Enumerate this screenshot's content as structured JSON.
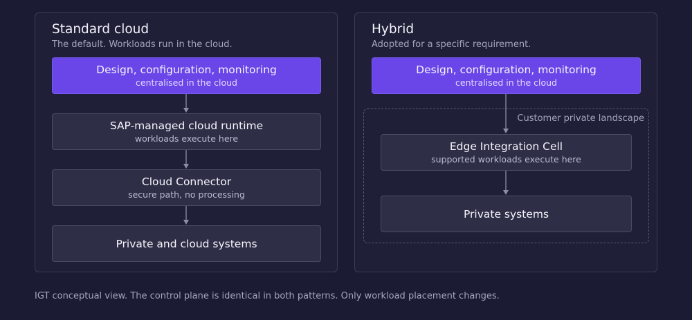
{
  "standard": {
    "title": "Standard cloud",
    "subtitle": "The default. Workloads run in the cloud.",
    "boxes": [
      {
        "title": "Design, configuration, monitoring",
        "subtitle": "centralised in the cloud"
      },
      {
        "title": "SAP-managed cloud runtime",
        "subtitle": "workloads execute here"
      },
      {
        "title": "Cloud Connector",
        "subtitle": "secure path, no processing"
      },
      {
        "title": "Private and cloud systems"
      }
    ]
  },
  "hybrid": {
    "title": "Hybrid",
    "subtitle": "Adopted for a specific requirement.",
    "boxes": [
      {
        "title": "Design, configuration, monitoring",
        "subtitle": "centralised in the cloud"
      },
      {
        "title": "Edge Integration Cell",
        "subtitle": "supported workloads execute here"
      },
      {
        "title": "Private systems"
      }
    ],
    "landscape_label": "Customer private landscape"
  },
  "footer": "IGT conceptual view. The control plane is identical in both patterns. Only workload placement changes.",
  "colors": {
    "background": "#1b1c33",
    "accent": "#6a45e8",
    "box": "#2e2f47",
    "border": "#4a4c66"
  }
}
